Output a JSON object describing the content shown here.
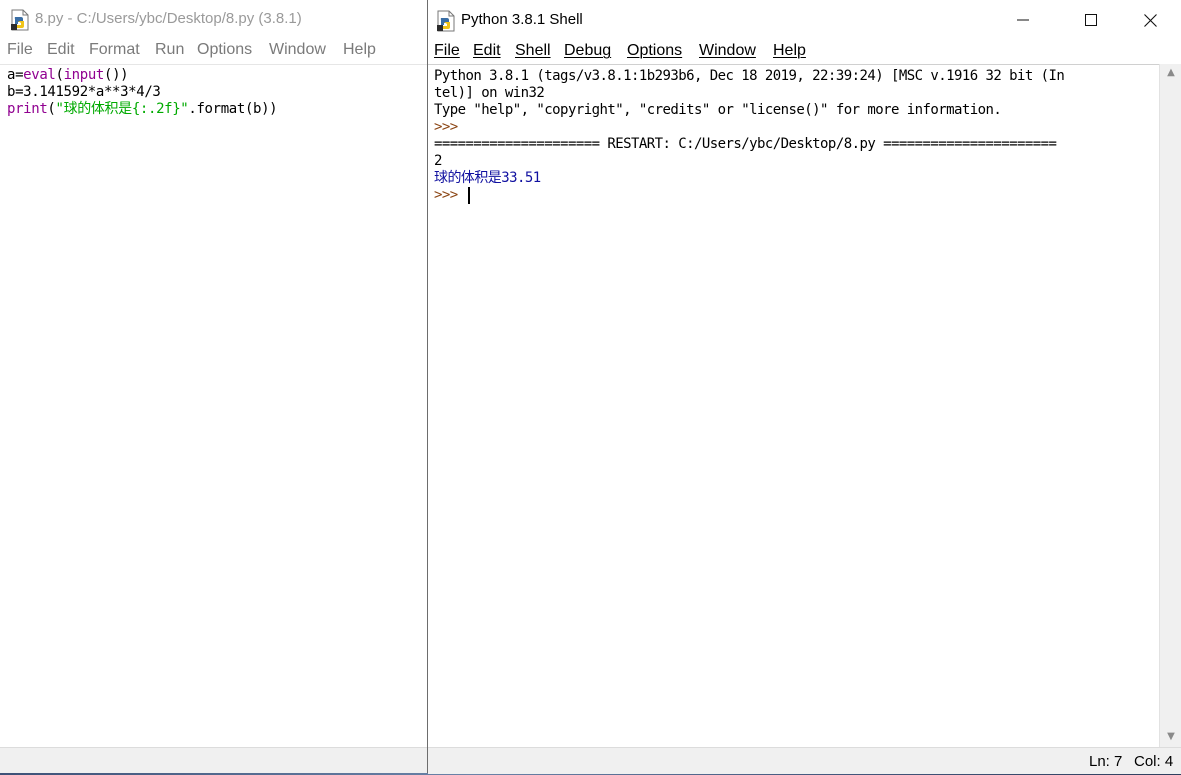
{
  "editor": {
    "title": "8.py - C:/Users/ybc/Desktop/8.py (3.8.1)",
    "menu": [
      "File",
      "Edit",
      "Format",
      "Run",
      "Options",
      "Window",
      "Help"
    ],
    "code": {
      "line1": {
        "a": "a=",
        "b": "eval",
        "c": "(",
        "d": "input",
        "e": "())"
      },
      "line2": "b=3.141592*a**3*4/3",
      "line3": {
        "a": "print",
        "b": "(",
        "c": "\"球的体积是{:.2f}\"",
        "d": ".format(b))"
      }
    }
  },
  "shell": {
    "title": "Python 3.8.1 Shell",
    "menu": [
      "File",
      "Edit",
      "Shell",
      "Debug",
      "Options",
      "Window",
      "Help"
    ],
    "lines": [
      "Python 3.8.1 (tags/v3.8.1:1b293b6, Dec 18 2019, 22:39:24) [MSC v.1916 32 bit (In",
      "tel)] on win32",
      "Type \"help\", \"copyright\", \"credits\" or \"license()\" for more information.",
      ">>>",
      "===================== RESTART: C:/Users/ybc/Desktop/8.py ======================",
      "2",
      "球的体积是33.51",
      ">>> "
    ],
    "status": {
      "line": "Ln: 7",
      "col": "Col: 4"
    }
  },
  "colors": {
    "keyword": "#900090",
    "string": "#00aa00",
    "prompt": "#8b4513",
    "output": "#1010a0"
  },
  "icons": [
    "python-file-icon",
    "python-shell-icon",
    "minimize-icon",
    "maximize-icon",
    "close-icon",
    "scroll-up-icon",
    "scroll-down-icon"
  ]
}
